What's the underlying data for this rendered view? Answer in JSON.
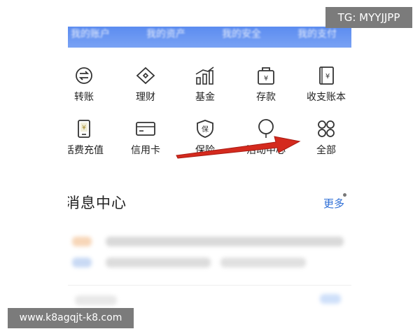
{
  "top_tabs": [
    "我的账户",
    "我的资产",
    "我的安全",
    "我的支付"
  ],
  "grid": {
    "row1": [
      {
        "label": "转账",
        "icon": "transfer-icon"
      },
      {
        "label": "理财",
        "icon": "diamond-icon"
      },
      {
        "label": "基金",
        "icon": "bar-chart-icon"
      },
      {
        "label": "存款",
        "icon": "deposit-bag-icon"
      },
      {
        "label": "收支账本",
        "icon": "ledger-book-icon"
      }
    ],
    "row2": [
      {
        "label": "话费充值",
        "icon": "phone-topup-icon"
      },
      {
        "label": "信用卡",
        "icon": "credit-card-icon"
      },
      {
        "label": "保险",
        "icon": "insurance-shield-icon"
      },
      {
        "label": "活动中心",
        "icon": "balloon-icon"
      },
      {
        "label": "全部",
        "icon": "all-grid-icon"
      }
    ]
  },
  "icon_glyphs": {
    "yen": "¥",
    "bao": "保"
  },
  "messages": {
    "title": "消息中心",
    "more": "更多"
  },
  "watermarks": {
    "tg": "TG: MYYJJPP",
    "url": "www.k8agqjt-k8.com"
  },
  "colors": {
    "accent_blue": "#2f6fd6",
    "header_blue": "#5b8cf0",
    "arrow_red": "#d42a1e"
  }
}
